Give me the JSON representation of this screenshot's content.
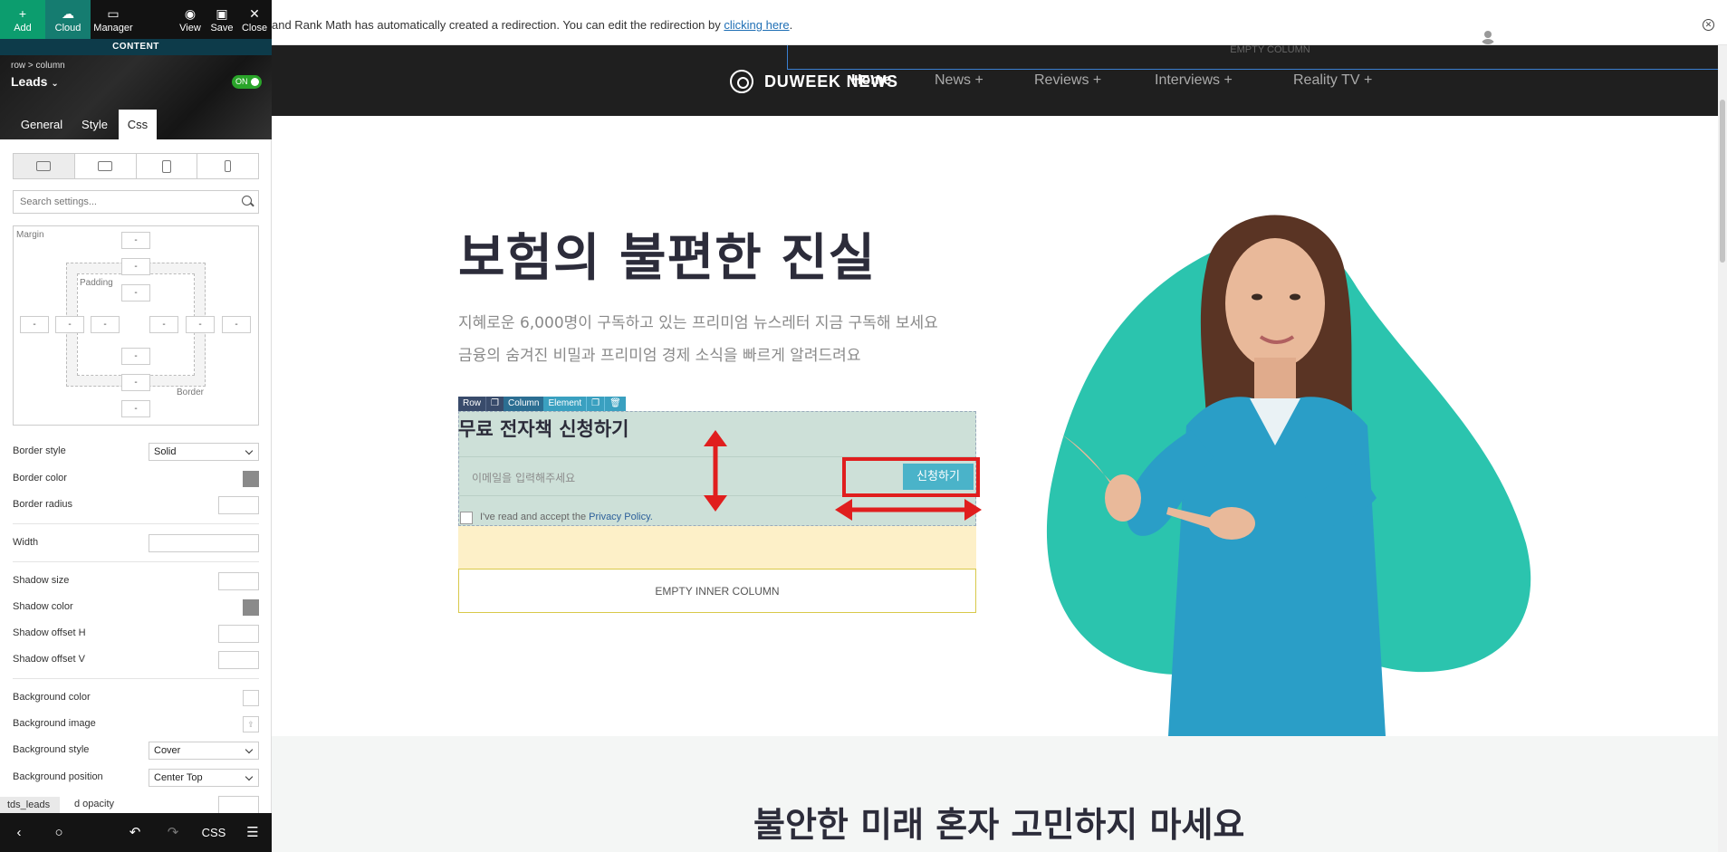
{
  "toolbar": {
    "add": "Add",
    "cloud": "Cloud",
    "manager": "Manager",
    "view": "View",
    "save": "Save",
    "close": "Close"
  },
  "sidebar": {
    "section_label": "CONTENT",
    "breadcrumb": "row > column",
    "title": "Leads",
    "toggle": "ON",
    "tabs": [
      "General",
      "Style",
      "Css"
    ],
    "active_tab": "Css",
    "search_placeholder": "Search settings...",
    "box_model": {
      "margin_label": "Margin",
      "padding_label": "Padding",
      "border_label": "Border",
      "empty_value": "-"
    },
    "props": {
      "border_style_label": "Border style",
      "border_style_value": "Solid",
      "border_color_label": "Border color",
      "border_radius_label": "Border radius",
      "width_label": "Width",
      "shadow_size_label": "Shadow size",
      "shadow_color_label": "Shadow color",
      "shadow_offset_h_label": "Shadow offset H",
      "shadow_offset_v_label": "Shadow offset V",
      "background_color_label": "Background color",
      "background_image_label": "Background image",
      "background_style_label": "Background style",
      "background_style_value": "Cover",
      "background_position_label": "Background position",
      "background_position_value": "Center Top",
      "background_opacity_label": "d opacity"
    },
    "element_tag": "tds_leads",
    "bottom_css": "CSS"
  },
  "notice": {
    "text": "and Rank Math has automatically created a redirection. You can edit the redirection by ",
    "link": "clicking here",
    "tail": "."
  },
  "site": {
    "empty_column": "EMPTY COLUMN",
    "logo": "DUWEEK NEWS",
    "nav": [
      "Home",
      "News  +",
      "Reviews  +",
      "Interviews  +",
      "Reality TV  +"
    ],
    "hero_title": "보험의 불편한 진실",
    "hero_sub1": "지혜로운 6,000명이 구독하고 있는 프리미엄 뉴스레터 지금 구독해 보세요",
    "hero_sub2": "금융의 숨겨진 비밀과 프리미엄 경제 소식을 빠르게 알려드려요",
    "edit_toolbar": {
      "row": "Row",
      "column": "Column",
      "element": "Element"
    },
    "lead_title": "무료 전자책 신청하기",
    "email_placeholder": "이메일을 입력해주세요",
    "submit": "신청하기",
    "privacy_text": "I've read and accept the ",
    "privacy_link": "Privacy Policy.",
    "empty_inner_column": "EMPTY INNER COLUMN",
    "band_title": "불안한 미래 혼자 고민하지 마세요"
  },
  "colors": {
    "annotation_red": "#e01e1e",
    "teal_blob": "#2bc4ae",
    "submit_button": "#4ab3c9",
    "lead_box_bg": "#cde0d8",
    "header_bg": "#1f1f1f"
  }
}
